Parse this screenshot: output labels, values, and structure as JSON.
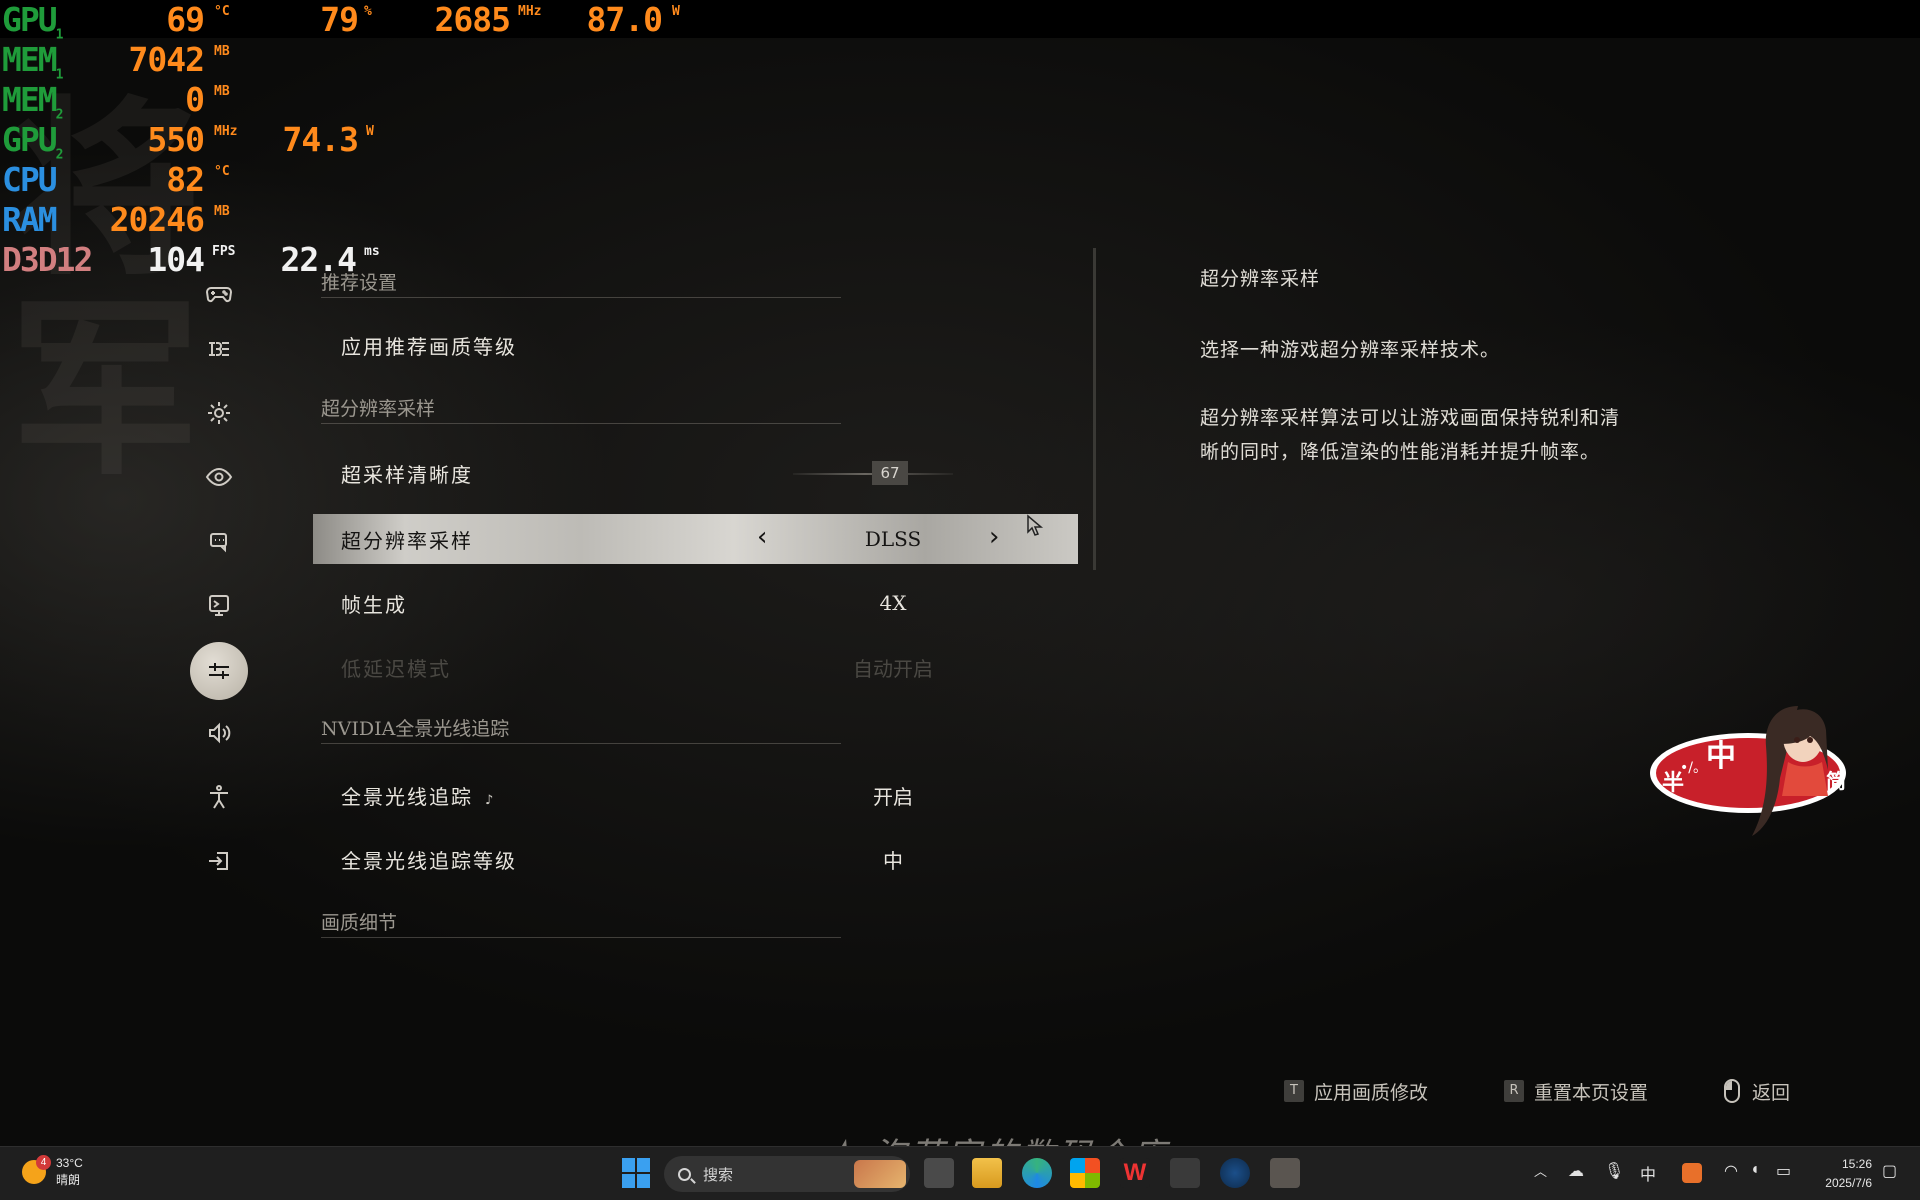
{
  "osd": {
    "gpu1": {
      "label": "GPU",
      "sub": "1",
      "temp": "69",
      "temp_unit": "°C",
      "load": "79",
      "load_unit": "%",
      "clock": "2685",
      "clock_unit": "MHz",
      "power": "87.0",
      "power_unit": "W"
    },
    "mem1": {
      "label": "MEM",
      "sub": "1",
      "value": "7042",
      "unit": "MB"
    },
    "mem2": {
      "label": "MEM",
      "sub": "2",
      "value": "0",
      "unit": "MB"
    },
    "gpu2": {
      "label": "GPU",
      "sub": "2",
      "clock": "550",
      "clock_unit": "MHz",
      "power": "74.3",
      "power_unit": "W"
    },
    "cpu": {
      "label": "CPU",
      "temp": "82",
      "temp_unit": "°C"
    },
    "ram": {
      "label": "RAM",
      "value": "20246",
      "unit": "MB"
    },
    "d3d": {
      "label": "D3D12",
      "fps": "104",
      "fps_unit": "FPS",
      "frametime": "22.4",
      "frametime_unit": "ms"
    }
  },
  "sidebar": {
    "icons": [
      "gamepad-icon",
      "controls-icon",
      "gear-icon",
      "eye-icon",
      "chat-icon",
      "display-icon",
      "graphics-sliders-icon",
      "audio-icon",
      "accessibility-icon",
      "exit-icon"
    ],
    "active_index": 6
  },
  "settings": {
    "sections": {
      "recommended": "推荐设置",
      "supersampling": "超分辨率采样",
      "raytracing": "NVIDIA全景光线追踪",
      "details": "画质细节"
    },
    "rows": {
      "apply_recommended": {
        "label": "应用推荐画质等级"
      },
      "sharpness": {
        "label": "超采样清晰度",
        "value": "67",
        "fraction": 0.67
      },
      "upscaler": {
        "label": "超分辨率采样",
        "value": "DLSS"
      },
      "frame_gen": {
        "label": "帧生成",
        "value": "4X"
      },
      "low_latency": {
        "label": "低延迟模式",
        "value": "自动开启",
        "disabled": true
      },
      "rt": {
        "label": "全景光线追踪",
        "value": "开启"
      },
      "rt_level": {
        "label": "全景光线追踪等级",
        "value": "中"
      }
    }
  },
  "description": {
    "title": "超分辨率采样",
    "p1": "选择一种游戏超分辨率采样技术。",
    "p2a": "超分辨率采样算法可以让游戏画面保持锐利和清",
    "p2b": "晰的同时，降低渲染的性能消耗并提升帧率。"
  },
  "hints": {
    "apply": {
      "key": "T",
      "label": "应用画质修改"
    },
    "reset": {
      "key": "R",
      "label": "重置本页设置"
    },
    "back": {
      "label": "返回"
    }
  },
  "sticker": {
    "left": "半",
    "center": "中",
    "right": "简",
    "mark": "•/。"
  },
  "watermark": "★ 泡芙家的数码仓库",
  "taskbar": {
    "weather_temp": "33°C",
    "weather_cond": "晴朗",
    "weather_badge": "4",
    "search_placeholder": "搜索",
    "ime": "中",
    "time": "15:26",
    "date": "2025/7/6"
  },
  "colors": {
    "osd_green": "#1f9c3a",
    "osd_orange": "#ff8a1c",
    "osd_blue": "#2b8fe0",
    "osd_pink": "#d27f80",
    "sticker_red": "#c8202a"
  }
}
